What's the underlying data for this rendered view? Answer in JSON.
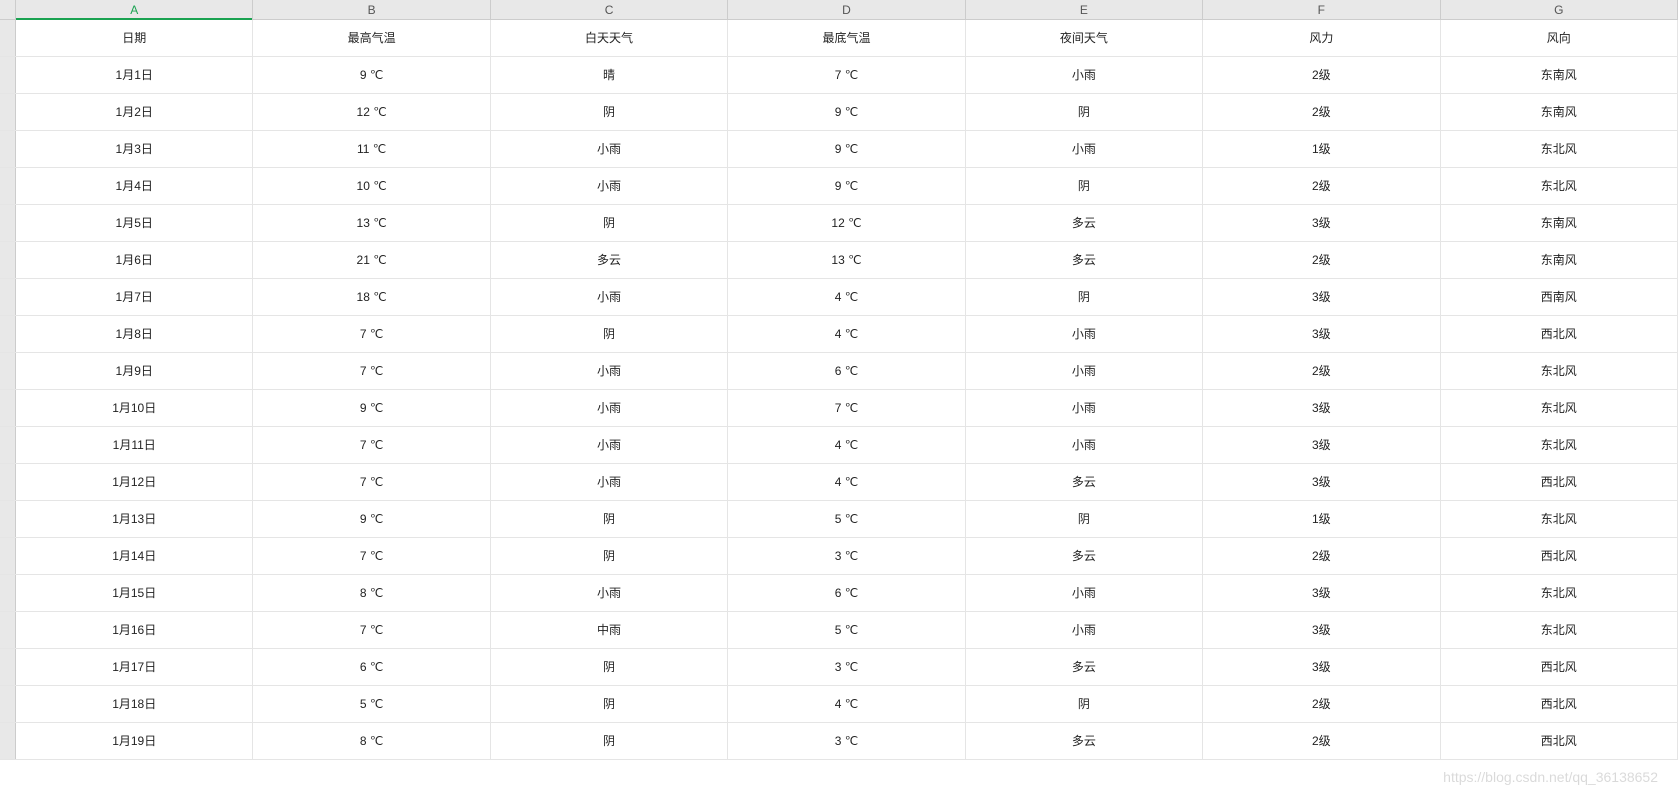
{
  "columns": [
    "A",
    "B",
    "C",
    "D",
    "E",
    "F",
    "G"
  ],
  "selectedColumn": 0,
  "headers": [
    "日期",
    "最高气温",
    "白天天气",
    "最底气温",
    "夜间天气",
    "风力",
    "风向"
  ],
  "rows": [
    [
      "1月1日",
      "9 ℃",
      "晴",
      "7 ℃",
      "小雨",
      "2级",
      "东南风"
    ],
    [
      "1月2日",
      "12 ℃",
      "阴",
      "9 ℃",
      "阴",
      "2级",
      "东南风"
    ],
    [
      "1月3日",
      "11 ℃",
      "小雨",
      "9 ℃",
      "小雨",
      "1级",
      "东北风"
    ],
    [
      "1月4日",
      "10 ℃",
      "小雨",
      "9 ℃",
      "阴",
      "2级",
      "东北风"
    ],
    [
      "1月5日",
      "13 ℃",
      "阴",
      "12 ℃",
      "多云",
      "3级",
      "东南风"
    ],
    [
      "1月6日",
      "21 ℃",
      "多云",
      "13 ℃",
      "多云",
      "2级",
      "东南风"
    ],
    [
      "1月7日",
      "18 ℃",
      "小雨",
      "4 ℃",
      "阴",
      "3级",
      "西南风"
    ],
    [
      "1月8日",
      "7 ℃",
      "阴",
      "4 ℃",
      "小雨",
      "3级",
      "西北风"
    ],
    [
      "1月9日",
      "7 ℃",
      "小雨",
      "6 ℃",
      "小雨",
      "2级",
      "东北风"
    ],
    [
      "1月10日",
      "9 ℃",
      "小雨",
      "7 ℃",
      "小雨",
      "3级",
      "东北风"
    ],
    [
      "1月11日",
      "7 ℃",
      "小雨",
      "4 ℃",
      "小雨",
      "3级",
      "东北风"
    ],
    [
      "1月12日",
      "7 ℃",
      "小雨",
      "4 ℃",
      "多云",
      "3级",
      "西北风"
    ],
    [
      "1月13日",
      "9 ℃",
      "阴",
      "5 ℃",
      "阴",
      "1级",
      "东北风"
    ],
    [
      "1月14日",
      "7 ℃",
      "阴",
      "3 ℃",
      "多云",
      "2级",
      "西北风"
    ],
    [
      "1月15日",
      "8 ℃",
      "小雨",
      "6 ℃",
      "小雨",
      "3级",
      "东北风"
    ],
    [
      "1月16日",
      "7 ℃",
      "中雨",
      "5 ℃",
      "小雨",
      "3级",
      "东北风"
    ],
    [
      "1月17日",
      "6 ℃",
      "阴",
      "3 ℃",
      "多云",
      "3级",
      "西北风"
    ],
    [
      "1月18日",
      "5 ℃",
      "阴",
      "4 ℃",
      "阴",
      "2级",
      "西北风"
    ],
    [
      "1月19日",
      "8 ℃",
      "阴",
      "3 ℃",
      "多云",
      "2级",
      "西北风"
    ]
  ],
  "watermark": "https://blog.csdn.net/qq_36138652"
}
